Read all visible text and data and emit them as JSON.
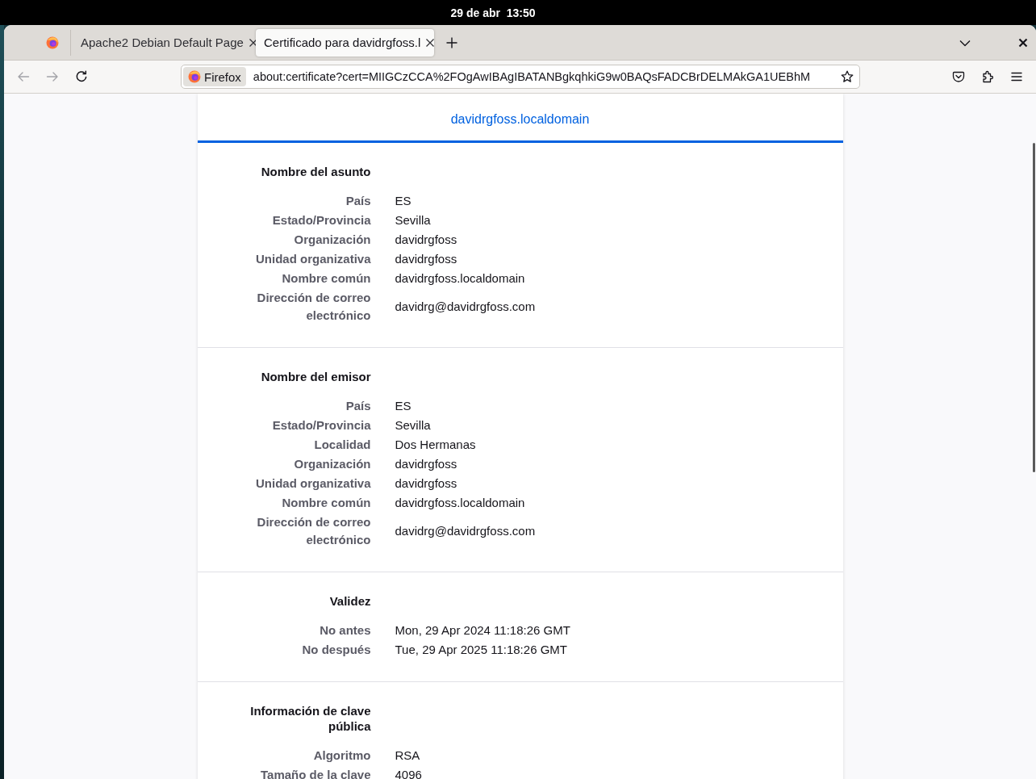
{
  "top_bar": {
    "clock": "29 de abr  13:50"
  },
  "browser": {
    "tabs": [
      {
        "title": "Apache2 Debian Default Page",
        "selected": false
      },
      {
        "title": "Certificado para davidrgfoss.l",
        "selected": true
      }
    ],
    "nav_buttons": [
      {
        "kind": "back",
        "disabled": true
      },
      {
        "kind": "forward",
        "disabled": true
      },
      {
        "kind": "reload",
        "disabled": false
      }
    ],
    "identity": "Firefox",
    "url": "about:certificate?cert=MIIGCzCCA%2FOgAwIBAgIBATANBgkqhkiG9w0BAQsFADCBrDELMAkGA1UEBhM"
  },
  "certificate": {
    "tabs": [
      {
        "label": "davidrgfoss.localdomain",
        "selected": true
      }
    ],
    "sections": [
      {
        "title": "Nombre del asunto",
        "rows": [
          {
            "label": "País",
            "value": "ES"
          },
          {
            "label": "Estado/Provincia",
            "value": "Sevilla"
          },
          {
            "label": "Organización",
            "value": "davidrgfoss"
          },
          {
            "label": "Unidad organizativa",
            "value": "davidrgfoss"
          },
          {
            "label": "Nombre común",
            "value": "davidrgfoss.localdomain"
          },
          {
            "label": "Dirección de correo electrónico",
            "value": "davidrg@davidrgfoss.com"
          }
        ]
      },
      {
        "title": "Nombre del emisor",
        "rows": [
          {
            "label": "País",
            "value": "ES"
          },
          {
            "label": "Estado/Provincia",
            "value": "Sevilla"
          },
          {
            "label": "Localidad",
            "value": "Dos Hermanas"
          },
          {
            "label": "Organización",
            "value": "davidrgfoss"
          },
          {
            "label": "Unidad organizativa",
            "value": "davidrgfoss"
          },
          {
            "label": "Nombre común",
            "value": "davidrgfoss.localdomain"
          },
          {
            "label": "Dirección de correo electrónico",
            "value": "davidrg@davidrgfoss.com"
          }
        ]
      },
      {
        "title": "Validez",
        "rows": [
          {
            "label": "No antes",
            "value": "Mon, 29 Apr 2024 11:18:26 GMT"
          },
          {
            "label": "No después",
            "value": "Tue, 29 Apr 2025 11:18:26 GMT"
          }
        ]
      },
      {
        "title": "Información de clave pública",
        "rows": [
          {
            "label": "Algoritmo",
            "value": "RSA"
          },
          {
            "label": "Tamaño de la clave",
            "value": "4096"
          }
        ]
      }
    ]
  }
}
